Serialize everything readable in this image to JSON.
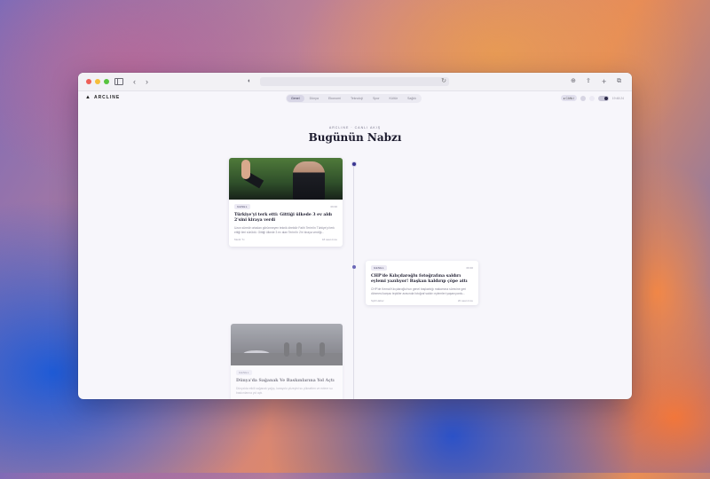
{
  "window": {
    "url": ""
  },
  "site": {
    "brand": "ARCLINE",
    "nav": [
      "Genel",
      "Dünya",
      "Ekonomi",
      "Teknoloji",
      "Spor",
      "Kültür",
      "Sağlık"
    ],
    "filter_pill": "● CANLI",
    "clock": "19:48:24"
  },
  "hero": {
    "eyebrow": "ARCLINE · CANLI AKIŞ",
    "title": "Bugünün Nabzı"
  },
  "cards": [
    {
      "tag": "GENEL",
      "stamp": "09:30",
      "title": "Türkiye'yi terk etti: Gittiği ülkede 3 ev aldı 2'sini kiraya verdi",
      "text": "Uzun süredir ortadan görünmeyen teknik direktör Fatih Terim'in Türkiye'yi terk ettiği ileri sürüldü. Gittiği ülkede 3 ev alan Terim'in 2'ni kiraya verdiği...",
      "source": "Medir Tv",
      "age": "18 saat önce"
    },
    {
      "tag": "GENEL",
      "stamp": "09:30",
      "title": "CHP'de Kılıçdaroğlu fotoğrafına saldırı eylemi yazılıyor! Başkan kaldırıp çöpe attı",
      "text": "CHP'de Kemal Kılıçdaroğlu'nun genel başkanlığı makamına sürecine geri dönmesi karşısı tepkiler arasında fotoğraf saldırı eylemleri yaşanıyordu...",
      "source": "Spill Haber",
      "age": "20 saat önce"
    },
    {
      "tag": "GENEL",
      "stamp": "",
      "title": "Dünya'da Sağanak Ve Baskınlarına Yol Açtı",
      "text": "Dünya'da etkili sağanak yağış, karayolu yüzeyini su yükselten ve evlere su baskınlarına yol açtı.",
      "source": "",
      "age": ""
    }
  ]
}
